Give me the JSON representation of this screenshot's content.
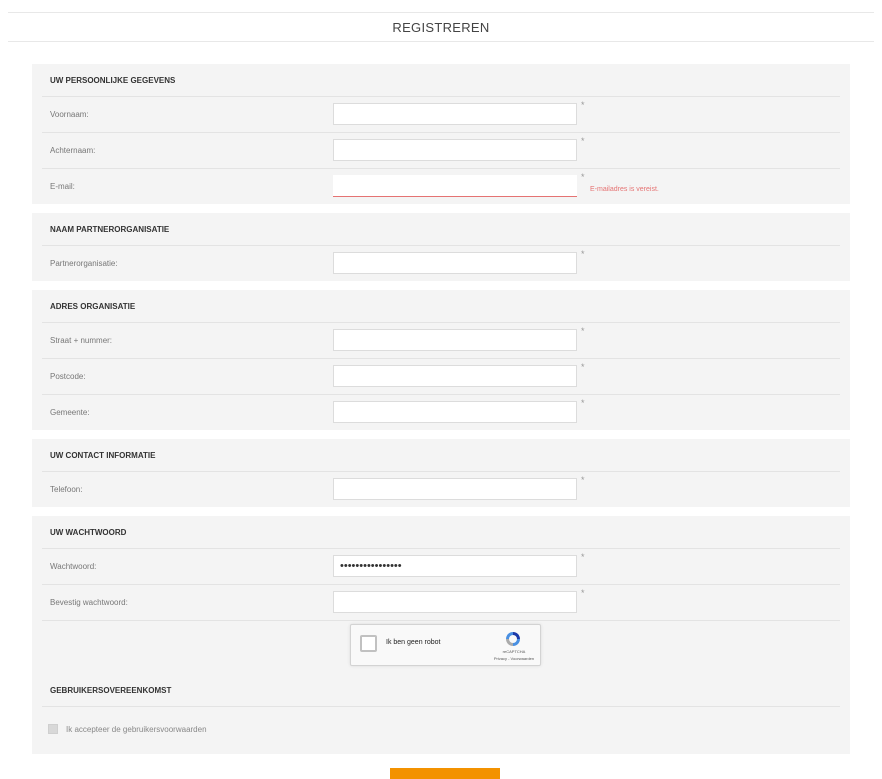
{
  "page": {
    "title": "REGISTREREN"
  },
  "sections": {
    "personal": {
      "title": "UW PERSOONLIJKE GEGEVENS",
      "first_name": {
        "label": "Voornaam:",
        "value": ""
      },
      "last_name": {
        "label": "Achternaam:",
        "value": ""
      },
      "email": {
        "label": "E-mail:",
        "value": "",
        "error": "E-mailadres is vereist."
      }
    },
    "partner": {
      "title": "NAAM PARTNERORGANISATIE",
      "organisation": {
        "label": "Partnerorganisatie:",
        "value": ""
      }
    },
    "address": {
      "title": "ADRES ORGANISATIE",
      "street": {
        "label": "Straat + nummer:",
        "value": ""
      },
      "postcode": {
        "label": "Postcode:",
        "value": ""
      },
      "city": {
        "label": "Gemeente:",
        "value": ""
      }
    },
    "contact": {
      "title": "UW CONTACT INFORMATIE",
      "phone": {
        "label": "Telefoon:",
        "value": ""
      }
    },
    "password": {
      "title": "UW WACHTWOORD",
      "password": {
        "label": "Wachtwoord:",
        "value": "••••••••••••••••"
      },
      "confirm": {
        "label": "Bevestig wachtwoord:",
        "value": ""
      }
    },
    "agreement": {
      "title": "GEBRUIKERSOVEREENKOMST",
      "accept_label": "Ik accepteer de gebruikersvoorwaarden"
    }
  },
  "required_mark": "*",
  "captcha": {
    "label": "Ik ben geen robot",
    "brand": "reCAPTCHA",
    "links": "Privacy - Voorwaarden"
  },
  "colors": {
    "accent": "#f39200",
    "error": "#e57373",
    "section_bg": "#f4f4f4"
  }
}
